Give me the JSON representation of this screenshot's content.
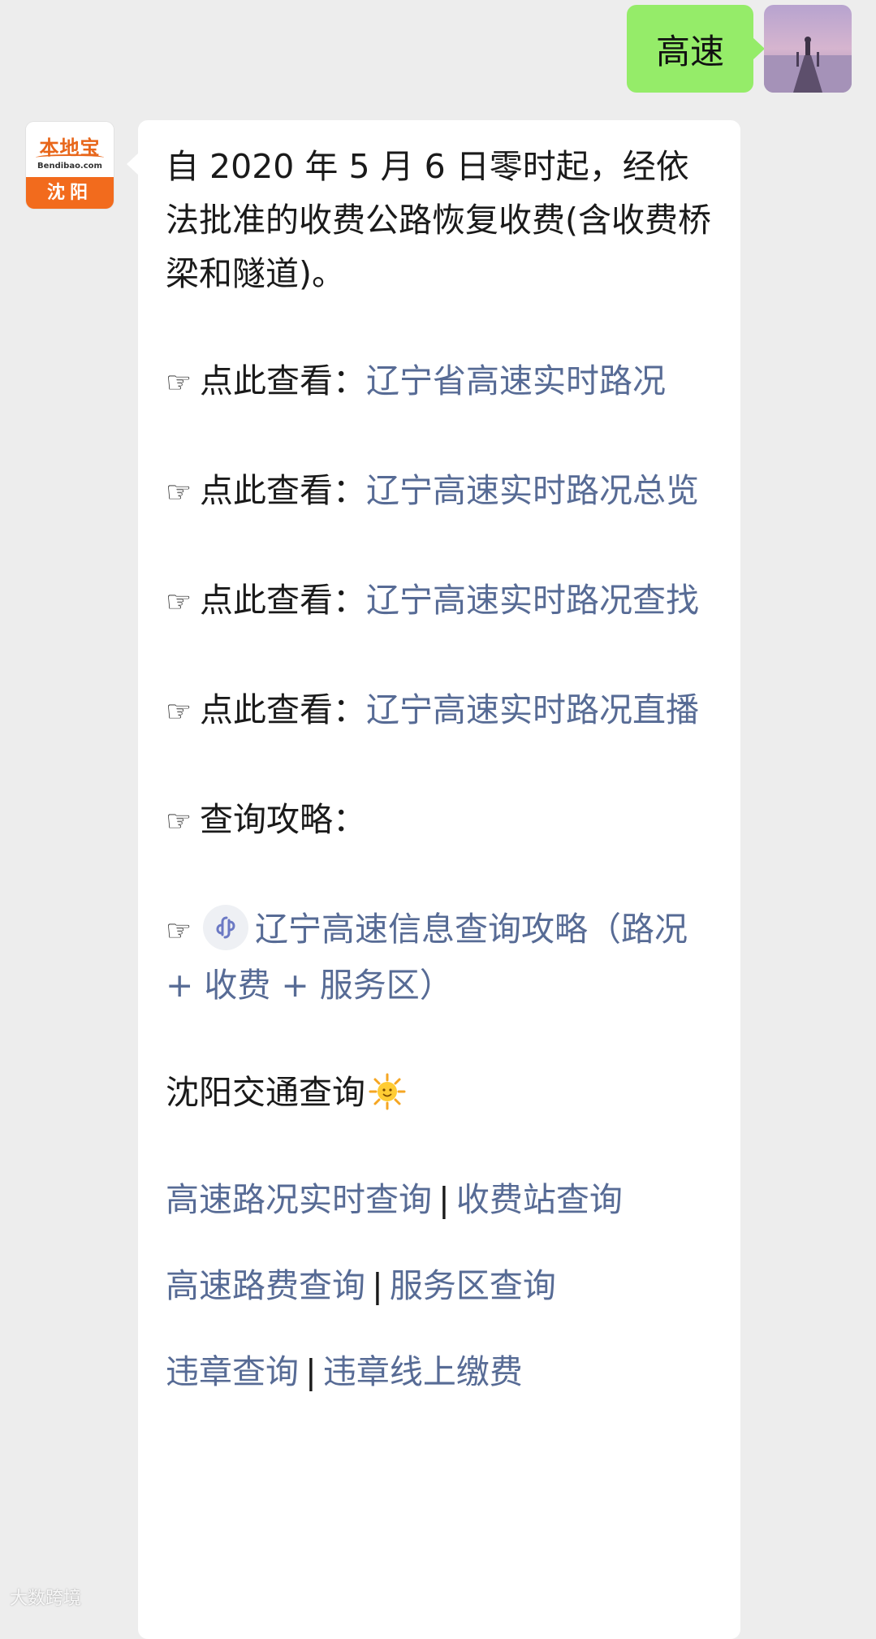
{
  "sent_message": {
    "text": "高速"
  },
  "sender_avatar": {
    "brand_name": "本地宝",
    "brand_domain": "Bendibao.com",
    "city": "沈阳"
  },
  "reply": {
    "intro": "自 2020 年 5 月 6 日零时起，经依法批准的收费公路恢复收费(含收费桥梁和隧道)。",
    "pointer_icon": "☞",
    "prefix": "点此查看：",
    "links": [
      "辽宁省高速实时路况",
      "辽宁高速实时路况总览",
      "辽宁高速实时路况查找",
      "辽宁高速实时路况直播"
    ],
    "guide_label": "查询攻略：",
    "mini_program_link": "辽宁高速信息查询攻略（路况 + 收费 + 服务区）",
    "traffic_heading": "沈阳交通查询",
    "separator": "|",
    "query_rows": [
      [
        "高速路况实时查询",
        "收费站查询"
      ],
      [
        "高速路费查询",
        "服务区查询"
      ],
      [
        "违章查询",
        "违章线上缴费"
      ]
    ]
  },
  "watermark": "大数跨境",
  "colors": {
    "chat_background": "#ededed",
    "sent_bubble": "#95ec69",
    "received_bubble": "#ffffff",
    "link": "#576b95",
    "brand_orange": "#f26b1d"
  }
}
